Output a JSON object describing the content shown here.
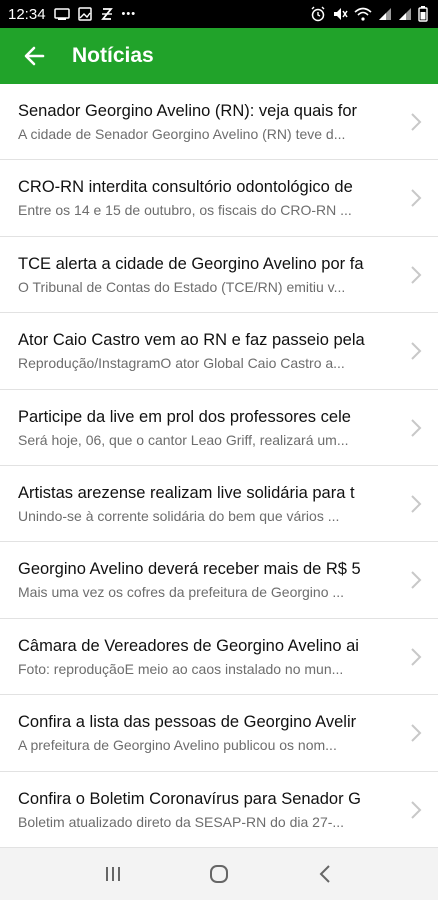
{
  "status_bar": {
    "time": "12:34",
    "dots": "•••",
    "icons_left": [
      "gallery-icon",
      "image-icon",
      "app-icon"
    ],
    "icons_right": [
      "alarm-icon",
      "mute-icon",
      "wifi-icon",
      "signal-icon",
      "signal-icon",
      "battery-icon"
    ]
  },
  "app_bar": {
    "title": "Notícias",
    "color": "#21a32a"
  },
  "news": [
    {
      "title": "Senador Georgino Avelino (RN): veja quais for",
      "snippet": "A cidade de Senador Georgino Avelino (RN) teve d..."
    },
    {
      "title": "CRO-RN interdita consultório odontológico de",
      "snippet": "Entre os 14 e 15 de outubro, os fiscais do CRO-RN ..."
    },
    {
      "title": "TCE alerta a cidade de Georgino Avelino por fa",
      "snippet": "O Tribunal de Contas do Estado (TCE/RN) emitiu v..."
    },
    {
      "title": "Ator Caio Castro vem ao RN e faz passeio pela",
      "snippet": "Reprodução/InstagramO ator Global Caio Castro a..."
    },
    {
      "title": "Participe da live em prol dos professores cele",
      "snippet": "Será hoje, 06, que o cantor Leao Griff, realizará um..."
    },
    {
      "title": "Artistas arezense realizam live solidária para t",
      "snippet": "Unindo-se à corrente solidária do bem que vários ..."
    },
    {
      "title": "Georgino Avelino deverá receber mais de R$ 5",
      "snippet": "Mais uma vez os cofres da prefeitura de Georgino ..."
    },
    {
      "title": "Câmara de Vereadores de Georgino Avelino ai",
      "snippet": "Foto: reproduçãoE meio ao caos instalado no mun..."
    },
    {
      "title": "Confira a lista das pessoas de Georgino Avelir",
      "snippet": " A prefeitura de Georgino Avelino publicou os nom..."
    },
    {
      "title": "Confira o Boletim Coronavírus para Senador G",
      "snippet": "Boletim atualizado direto da SESAP-RN do dia 27-..."
    }
  ],
  "nav_bar": {
    "buttons": [
      "recent-apps-icon",
      "home-icon",
      "back-icon"
    ]
  }
}
